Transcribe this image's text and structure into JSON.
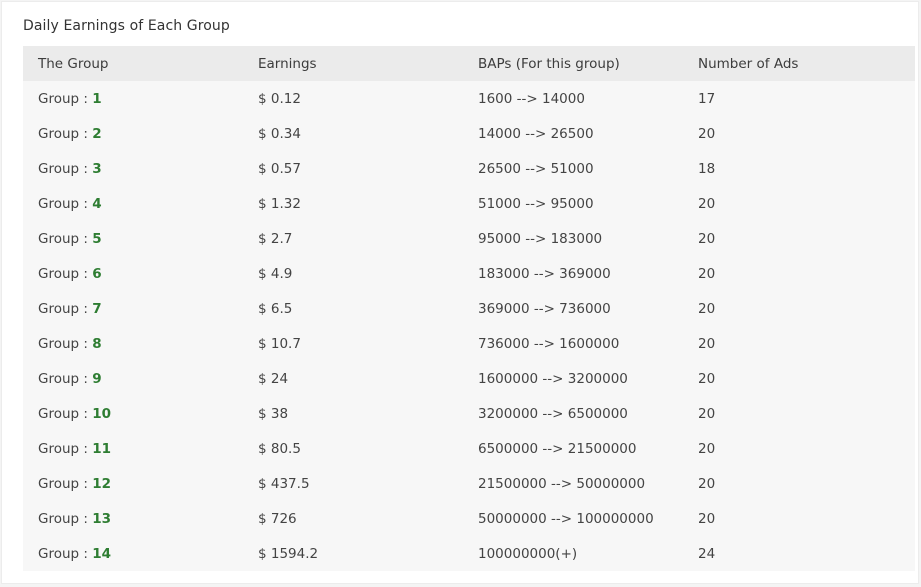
{
  "title": "Daily Earnings of Each Group",
  "colors": {
    "group_number": "#2e7d32",
    "header_bg": "#ebebeb",
    "row_bg": "#f7f7f7"
  },
  "table": {
    "headers": [
      "The Group",
      "Earnings",
      "BAPs (For this group)",
      "Number of Ads"
    ],
    "rows": [
      {
        "prefix": "Group : ",
        "num": "1",
        "earnings": "$ 0.12",
        "baps": "1600 --> 14000",
        "ads": "17"
      },
      {
        "prefix": "Group : ",
        "num": "2",
        "earnings": "$ 0.34",
        "baps": "14000 --> 26500",
        "ads": "20"
      },
      {
        "prefix": "Group : ",
        "num": "3",
        "earnings": "$ 0.57",
        "baps": "26500 --> 51000",
        "ads": "18"
      },
      {
        "prefix": "Group : ",
        "num": "4",
        "earnings": "$ 1.32",
        "baps": "51000 --> 95000",
        "ads": "20"
      },
      {
        "prefix": "Group : ",
        "num": "5",
        "earnings": "$ 2.7",
        "baps": "95000 --> 183000",
        "ads": "20"
      },
      {
        "prefix": "Group : ",
        "num": "6",
        "earnings": "$ 4.9",
        "baps": "183000 --> 369000",
        "ads": "20"
      },
      {
        "prefix": "Group : ",
        "num": "7",
        "earnings": "$ 6.5",
        "baps": "369000 --> 736000",
        "ads": "20"
      },
      {
        "prefix": "Group : ",
        "num": "8",
        "earnings": "$ 10.7",
        "baps": "736000 --> 1600000",
        "ads": "20"
      },
      {
        "prefix": "Group : ",
        "num": "9",
        "earnings": "$ 24",
        "baps": "1600000 --> 3200000",
        "ads": "20"
      },
      {
        "prefix": "Group : ",
        "num": "10",
        "earnings": "$ 38",
        "baps": "3200000 --> 6500000",
        "ads": "20"
      },
      {
        "prefix": "Group : ",
        "num": "11",
        "earnings": "$ 80.5",
        "baps": "6500000 --> 21500000",
        "ads": "20"
      },
      {
        "prefix": "Group : ",
        "num": "12",
        "earnings": "$ 437.5",
        "baps": "21500000 --> 50000000",
        "ads": "20"
      },
      {
        "prefix": "Group : ",
        "num": "13",
        "earnings": "$ 726",
        "baps": "50000000 --> 100000000",
        "ads": "20"
      },
      {
        "prefix": "Group : ",
        "num": "14",
        "earnings": "$ 1594.2",
        "baps": "100000000(+)",
        "ads": "24"
      }
    ]
  }
}
